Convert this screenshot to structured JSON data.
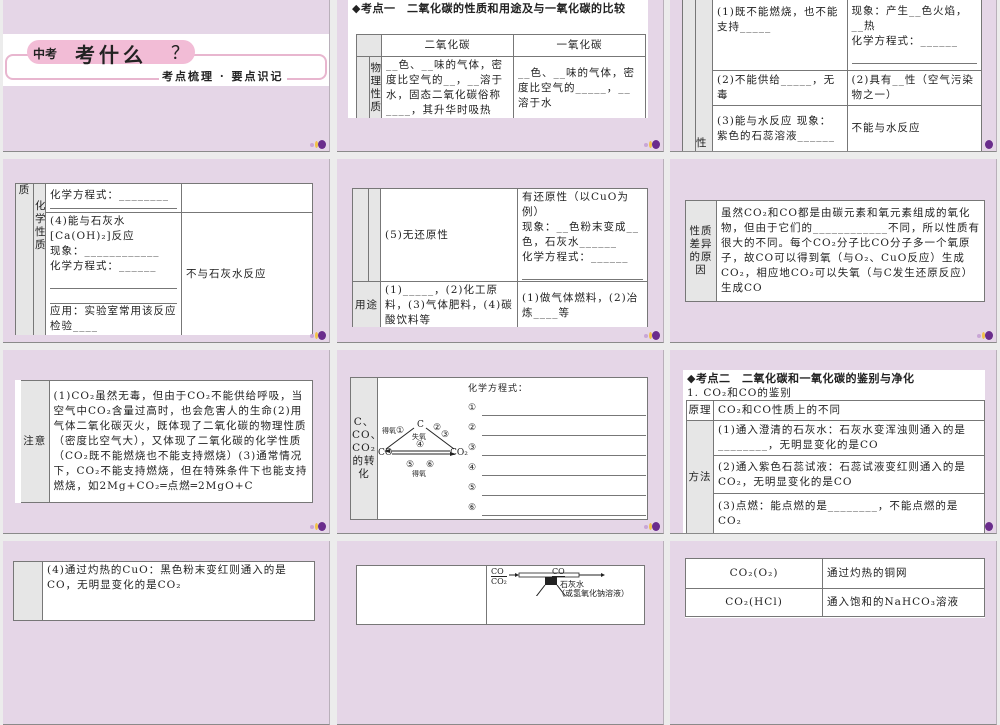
{
  "slide1": {
    "title_small": "中考",
    "title_big": "考什么",
    "title_q": "？",
    "subtitle": "考点梳理 · 要点识记"
  },
  "slide2": {
    "heading": "◆考点一　二氧化碳的性质和用途及与一氧化碳的比较",
    "col_co2": "二氧化碳",
    "col_co": "一氧化碳",
    "row_label": "物理性质",
    "co2_text": "__色、__味的气体，密度比空气的__，__溶于水，固态二氧化碳俗称____，其升华时吸热",
    "co_text": "__色、__味的气体，密度比空气的_____，__溶于水"
  },
  "slide3": {
    "r1_left": "(1)既不能燃烧，也不能支持_____",
    "r1_right_a": "现象：产生__色火焰，__热",
    "r1_right_b": "化学方程式：______",
    "r2_left": "(2)不能供给_____，无毒",
    "r2_right": "(2)具有__性（空气污染物之一）",
    "r3_left": "(3)能与水反应 现象：紫色的石蕊溶液______",
    "r3_right": "不能与水反应",
    "side": "性"
  },
  "slide4": {
    "side": "质",
    "sub": "化学性质",
    "r1_left": "化学方程式：________",
    "r2_a": "(4)能与石灰水",
    "r2_b": "[Ca(OH)₂]反应",
    "r2_c": "现象：____________",
    "r2_d": "化学方程式：______",
    "r2_e": "应用：实验室常用该反应检验____",
    "right": "不与石灰水反应"
  },
  "slide5": {
    "left": "(5)无还原性",
    "right_a": "有还原性（以CuO为例）",
    "right_b": "现象：__色粉末变成__色，石灰水______",
    "right_c": "化学方程式：______",
    "use_label": "用途",
    "use_co2": "(1)_____，(2)化工原料，(3)气体肥料，(4)碳酸饮料等",
    "use_co": "(1)做气体燃料，(2)冶炼____等"
  },
  "slide6": {
    "label": "性质差异的原因",
    "text": "虽然CO₂和CO都是由碳元素和氧元素组成的氧化物，但由于它们的____________不同，所以性质有很大的不同。每个CO₂分子比CO分子多一个氧原子，故CO可以得到氧（与O₂、CuO反应）生成CO₂，相应地CO₂可以失氧（与C发生还原反应）生成CO"
  },
  "slide7": {
    "label": "注意",
    "text": "(1)CO₂虽然无毒，但由于CO₂不能供给呼吸，当空气中CO₂含量过高时，也会危害人的生命(2)用气体二氧化碳灭火，既体现了二氧化碳的物理性质（密度比空气大），又体现了二氧化碳的化学性质（CO₂既不能燃烧也不能支持燃烧）(3)通常情况下，CO₂不能支持燃烧，但在特殊条件下也能支持燃烧，如2Mg+CO₂═点燃═2MgO+C"
  },
  "slide8": {
    "label": "C、CO、CO₂的转化",
    "c": "C",
    "co": "CO",
    "co2": "CO₂",
    "gain_o": "得氧",
    "lose_o": "失氧",
    "gain_o2": "得氧",
    "n1": "①",
    "n2": "②",
    "n3": "③",
    "n4": "④",
    "n5": "⑤",
    "n6": "⑥",
    "eq_title": "化学方程式：",
    "eqs": [
      "①",
      "②",
      "③",
      "④",
      "⑤",
      "⑥"
    ]
  },
  "slide9": {
    "heading": "◆考点二　二氧化碳和一氧化碳的鉴别与净化",
    "sub": "1. CO₂和CO的鉴别",
    "principle_label": "原理",
    "principle": "CO₂和CO性质上的不同",
    "method_label": "方法",
    "m1": "(1)通入澄清的石灰水：石灰水变浑浊则通入的是________，无明显变化的是CO",
    "m2": "(2)通入紫色石蕊试液：石蕊试液变红则通入的是CO₂，无明显变化的是CO",
    "m3": "(3)点燃：能点燃的是________，不能点燃的是CO₂"
  },
  "slide10": {
    "text": "(4)通过灼热的CuO：黑色粉末变红则通入的是CO，无明显变化的是CO₂"
  },
  "slide11": {
    "in_co": "CO",
    "in_co2": "CO₂",
    "out_co": "CO",
    "lime": "石灰水",
    "naoh": "（或氢氧化钠溶液）"
  },
  "slide12": {
    "rows": [
      {
        "gas": "CO₂(O₂)",
        "method": "通过灼热的铜网"
      },
      {
        "gas": "CO₂(HCl)",
        "method": "通入饱和的NaHCO₃溶液"
      }
    ]
  }
}
